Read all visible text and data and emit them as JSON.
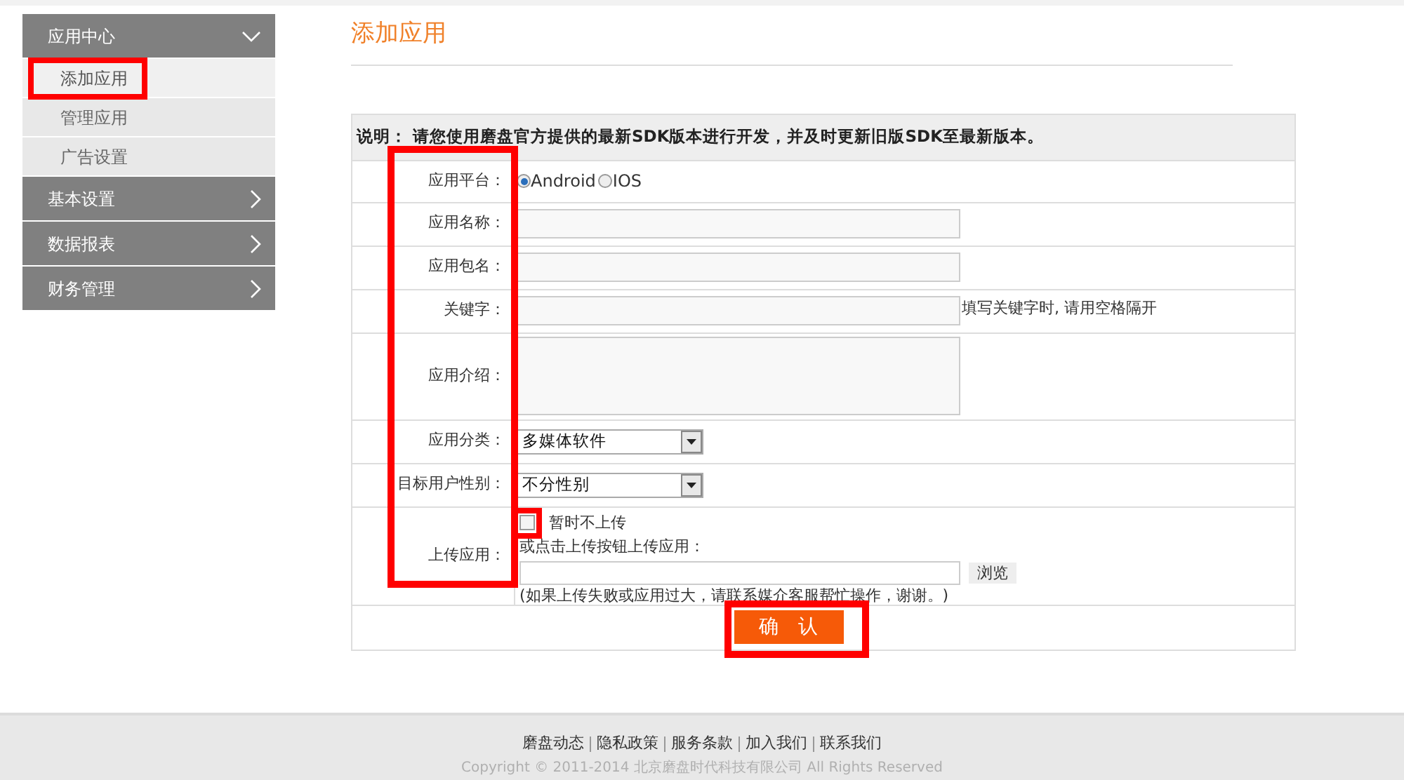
{
  "sidebar": {
    "groups": [
      {
        "label": "应用中心",
        "expanded": true,
        "children": [
          {
            "label": "添加应用",
            "selected": true
          },
          {
            "label": "管理应用",
            "selected": false
          },
          {
            "label": "广告设置",
            "selected": false
          }
        ]
      },
      {
        "label": "基本设置",
        "expanded": false
      },
      {
        "label": "数据报表",
        "expanded": false
      },
      {
        "label": "财务管理",
        "expanded": false
      }
    ]
  },
  "page_title": "添加应用",
  "form": {
    "notice": "说明： 请您使用磨盘官方提供的最新SDK版本进行开发，并及时更新旧版SDK至最新版本。",
    "rows": [
      {
        "kind": "radio",
        "label": "应用平台：",
        "options": [
          {
            "label": "Android",
            "selected": true
          },
          {
            "label": "IOS",
            "selected": false
          }
        ]
      },
      {
        "kind": "text",
        "label": "应用名称："
      },
      {
        "kind": "text",
        "label": "应用包名："
      },
      {
        "kind": "text",
        "label": "关键字：",
        "hint": "填写关键字时, 请用空格隔开"
      },
      {
        "kind": "textarea",
        "label": "应用介绍："
      },
      {
        "kind": "select",
        "label": "应用分类：",
        "value": "多媒体软件"
      },
      {
        "kind": "select",
        "label": "目标用户性别：",
        "value": "不分性别"
      },
      {
        "kind": "upload",
        "label": "上传应用：",
        "checkbox": {
          "label": "暂时不上传",
          "checked": false
        },
        "instruction": "或点击上传按钮上传应用：",
        "browse": "浏览",
        "note": "(如果上传失败或应用过大，请联系媒介客服帮忙操作，谢谢。)"
      }
    ],
    "submit": "确　认"
  },
  "footer": {
    "links": [
      "磨盘动态",
      "隐私政策",
      "服务条款",
      "加入我们",
      "联系我们"
    ],
    "copyright": "Copyright © 2011-2014 北京磨盘时代科技有限公司 All Rights Reserved"
  }
}
